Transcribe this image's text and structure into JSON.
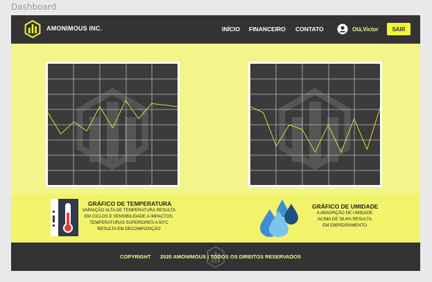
{
  "canvas": {
    "label": "Dashboard"
  },
  "header": {
    "brand": "AMONIMOUS INC.",
    "nav": [
      {
        "label": "INÍCIO"
      },
      {
        "label": "FINANCEIRO"
      },
      {
        "label": "CONTATO"
      }
    ],
    "greeting": "Olá,Victor",
    "logout_label": "SAIR"
  },
  "charts": [
    {
      "name": "temperature",
      "line_values": [
        0.52,
        0.38,
        0.46,
        0.4,
        0.56,
        0.42,
        0.6,
        0.48,
        0.58,
        0.57,
        0.56
      ]
    },
    {
      "name": "humidity",
      "line_values": [
        0.56,
        0.52,
        0.3,
        0.44,
        0.41,
        0.26,
        0.44,
        0.26,
        0.48,
        0.28,
        0.55
      ]
    }
  ],
  "info": {
    "temperature": {
      "title": "GRÁFICO DE TEMPERATURA",
      "lines": [
        "VARIAÇÃO ALTA DE TEMPERATURA RESULTA",
        "EM CICLOS E SENSIBILIDADE A IMPACTOS.",
        "TEMPERATURAS SUPERIORES A 50°C",
        "RESULTA EM DECOMPOSIÇÃO"
      ]
    },
    "humidity": {
      "title": "GRÁFICO DE UMIDADE",
      "lines": [
        "A ABSORÇÃO DE UMIDADE",
        "ACIMA DE 59,4% RESULTA",
        "EM EMPEDRAMENTO"
      ]
    }
  },
  "footer": {
    "copyright": "COPYRIGHT",
    "rights": "2020 AMONIMOUS | TODOS OS DIREITOS RESERVADOS"
  },
  "colors": {
    "header_bg": "#333333",
    "page_bg": "#f3f58a",
    "accent": "#f3f532",
    "chart_line": "#e8ec3a",
    "drop": "#3e8ed0"
  },
  "icons": {
    "logo": "bar-chart-logo-icon",
    "user": "user-circle-icon",
    "thermometer": "thermometer-icon",
    "drops": "water-drops-icon"
  }
}
